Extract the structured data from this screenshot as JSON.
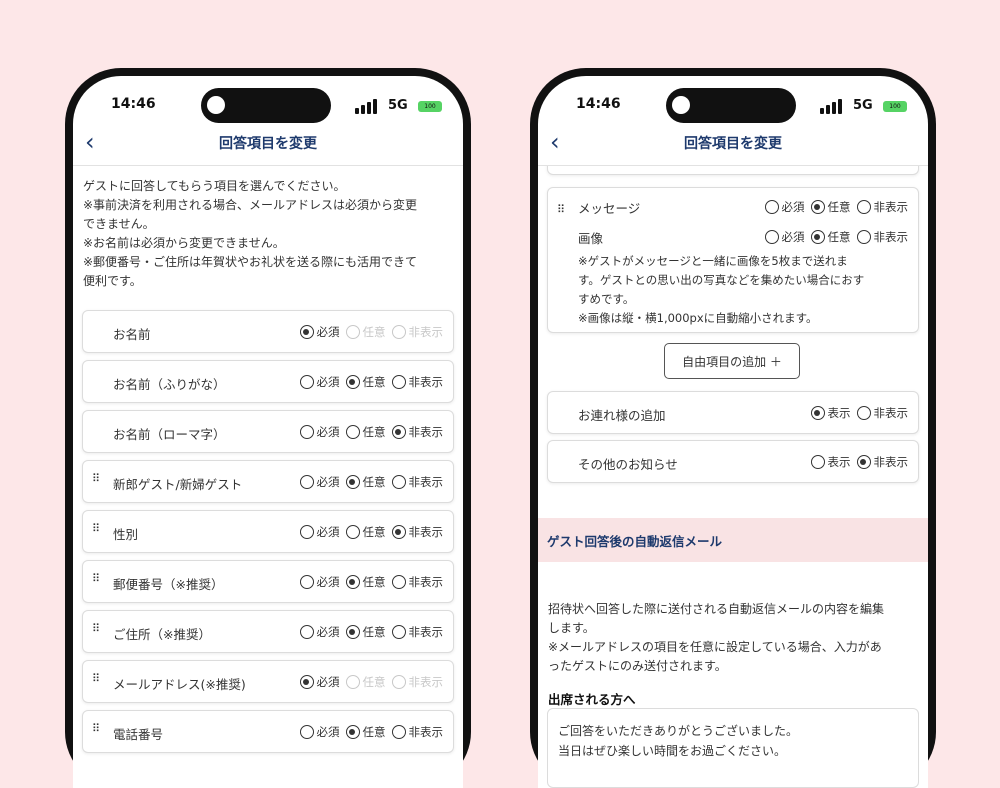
{
  "left_phone": {
    "time": "14:46",
    "network": "5G",
    "battery": "100",
    "nav_title": "回答項目を変更",
    "intro_lines": [
      "ゲストに回答してもらう項目を選んでください。",
      "※事前決済を利用される場合、メールアドレスは必須から変更",
      "できません。",
      "※お名前は必須から変更できません。",
      "※郵便番号・ご住所は年賀状やお礼状を送る際にも活用できて",
      "便利です。"
    ],
    "rows": [
      {
        "label": "お名前",
        "drag": false,
        "opt1": "必須",
        "opt2": "任意",
        "opt3": "非表示",
        "selected": 1,
        "disabled": true
      },
      {
        "label": "お名前（ふりがな）",
        "drag": false,
        "opt1": "必須",
        "opt2": "任意",
        "opt3": "非表示",
        "selected": 2,
        "disabled": false
      },
      {
        "label": "お名前（ローマ字）",
        "drag": false,
        "opt1": "必須",
        "opt2": "任意",
        "opt3": "非表示",
        "selected": 3,
        "disabled": false
      },
      {
        "label": "新郎ゲスト/新婦ゲスト",
        "drag": true,
        "opt1": "必須",
        "opt2": "任意",
        "opt3": "非表示",
        "selected": 2,
        "disabled": false
      },
      {
        "label": "性別",
        "drag": true,
        "opt1": "必須",
        "opt2": "任意",
        "opt3": "非表示",
        "selected": 3,
        "disabled": false
      },
      {
        "label": "郵便番号（※推奨）",
        "drag": true,
        "opt1": "必須",
        "opt2": "任意",
        "opt3": "非表示",
        "selected": 2,
        "disabled": false
      },
      {
        "label": "ご住所（※推奨）",
        "drag": true,
        "opt1": "必須",
        "opt2": "任意",
        "opt3": "非表示",
        "selected": 2,
        "disabled": false
      },
      {
        "label": "メールアドレス(※推奨)",
        "drag": true,
        "opt1": "必須",
        "opt2": "任意",
        "opt3": "非表示",
        "selected": 1,
        "disabled": true
      },
      {
        "label": "電話番号",
        "drag": true,
        "opt1": "必須",
        "opt2": "任意",
        "opt3": "非表示",
        "selected": 2,
        "disabled": false
      }
    ]
  },
  "right_phone": {
    "time": "14:46",
    "network": "5G",
    "battery": "100",
    "nav_title": "回答項目を変更",
    "message_card": {
      "label": "メッセージ",
      "opt1": "必須",
      "opt2": "任意",
      "opt3": "非表示",
      "selected": 2,
      "image_label": "画像",
      "image_selected": 2,
      "note_lines": [
        "※ゲストがメッセージと一緒に画像を5枚まで送れま",
        "す。ゲストとの思い出の写真などを集めたい場合におす",
        "すめです。",
        "※画像は縦・横1,000pxに自動縮小されます。"
      ]
    },
    "add_button": "自由項目の追加 ＋",
    "companion": {
      "label": "お連れ様の追加",
      "opt1": "表示",
      "opt2": "非表示",
      "selected": 1
    },
    "other_notice": {
      "label": "その他のお知らせ",
      "opt1": "表示",
      "opt2": "非表示",
      "selected": 2
    },
    "section_title": "ゲスト回答後の自動返信メール",
    "para_lines": [
      "招待状へ回答した際に送付される自動返信メールの内容を編集",
      "します。",
      "※メールアドレスの項目を任意に設定している場合、入力があ",
      "ったゲストにのみ送付されます。"
    ],
    "attend_title": "出席される方へ",
    "attend_text_lines": [
      "ご回答をいただきありがとうございました。",
      "当日はぜひ楽しい時間をお過ごください。"
    ]
  }
}
